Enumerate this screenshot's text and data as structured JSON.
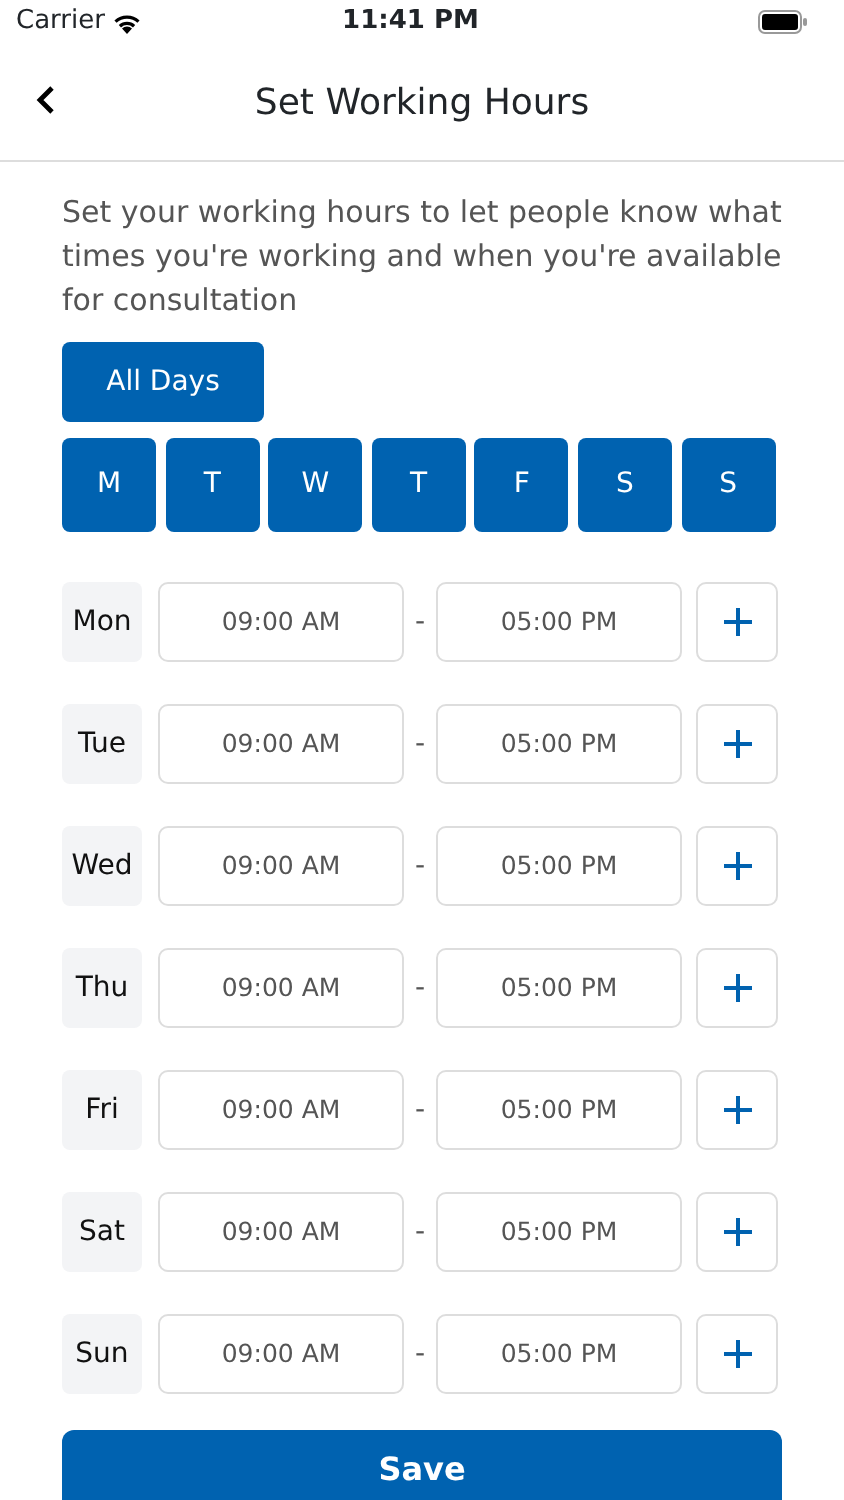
{
  "status_bar": {
    "carrier": "Carrier",
    "time": "11:41 PM"
  },
  "nav": {
    "title": "Set Working Hours"
  },
  "description": "Set your working hours to let people know what times you're working and when you're available for consultation",
  "all_days_button": "All Days",
  "day_chips": [
    {
      "label": "M",
      "selected": true
    },
    {
      "label": "T",
      "selected": true
    },
    {
      "label": "W",
      "selected": true
    },
    {
      "label": "T",
      "selected": true
    },
    {
      "label": "F",
      "selected": true
    },
    {
      "label": "S",
      "selected": true
    },
    {
      "label": "S",
      "selected": true
    }
  ],
  "schedule": [
    {
      "day": "Mon",
      "start": "09:00 AM",
      "separator": "-",
      "end": "05:00 PM"
    },
    {
      "day": "Tue",
      "start": "09:00 AM",
      "separator": "-",
      "end": "05:00 PM"
    },
    {
      "day": "Wed",
      "start": "09:00 AM",
      "separator": "-",
      "end": "05:00 PM"
    },
    {
      "day": "Thu",
      "start": "09:00 AM",
      "separator": "-",
      "end": "05:00 PM"
    },
    {
      "day": "Fri",
      "start": "09:00 AM",
      "separator": "-",
      "end": "05:00 PM"
    },
    {
      "day": "Sat",
      "start": "09:00 AM",
      "separator": "-",
      "end": "05:00 PM"
    },
    {
      "day": "Sun",
      "start": "09:00 AM",
      "separator": "-",
      "end": "05:00 PM"
    }
  ],
  "save_button": "Save"
}
